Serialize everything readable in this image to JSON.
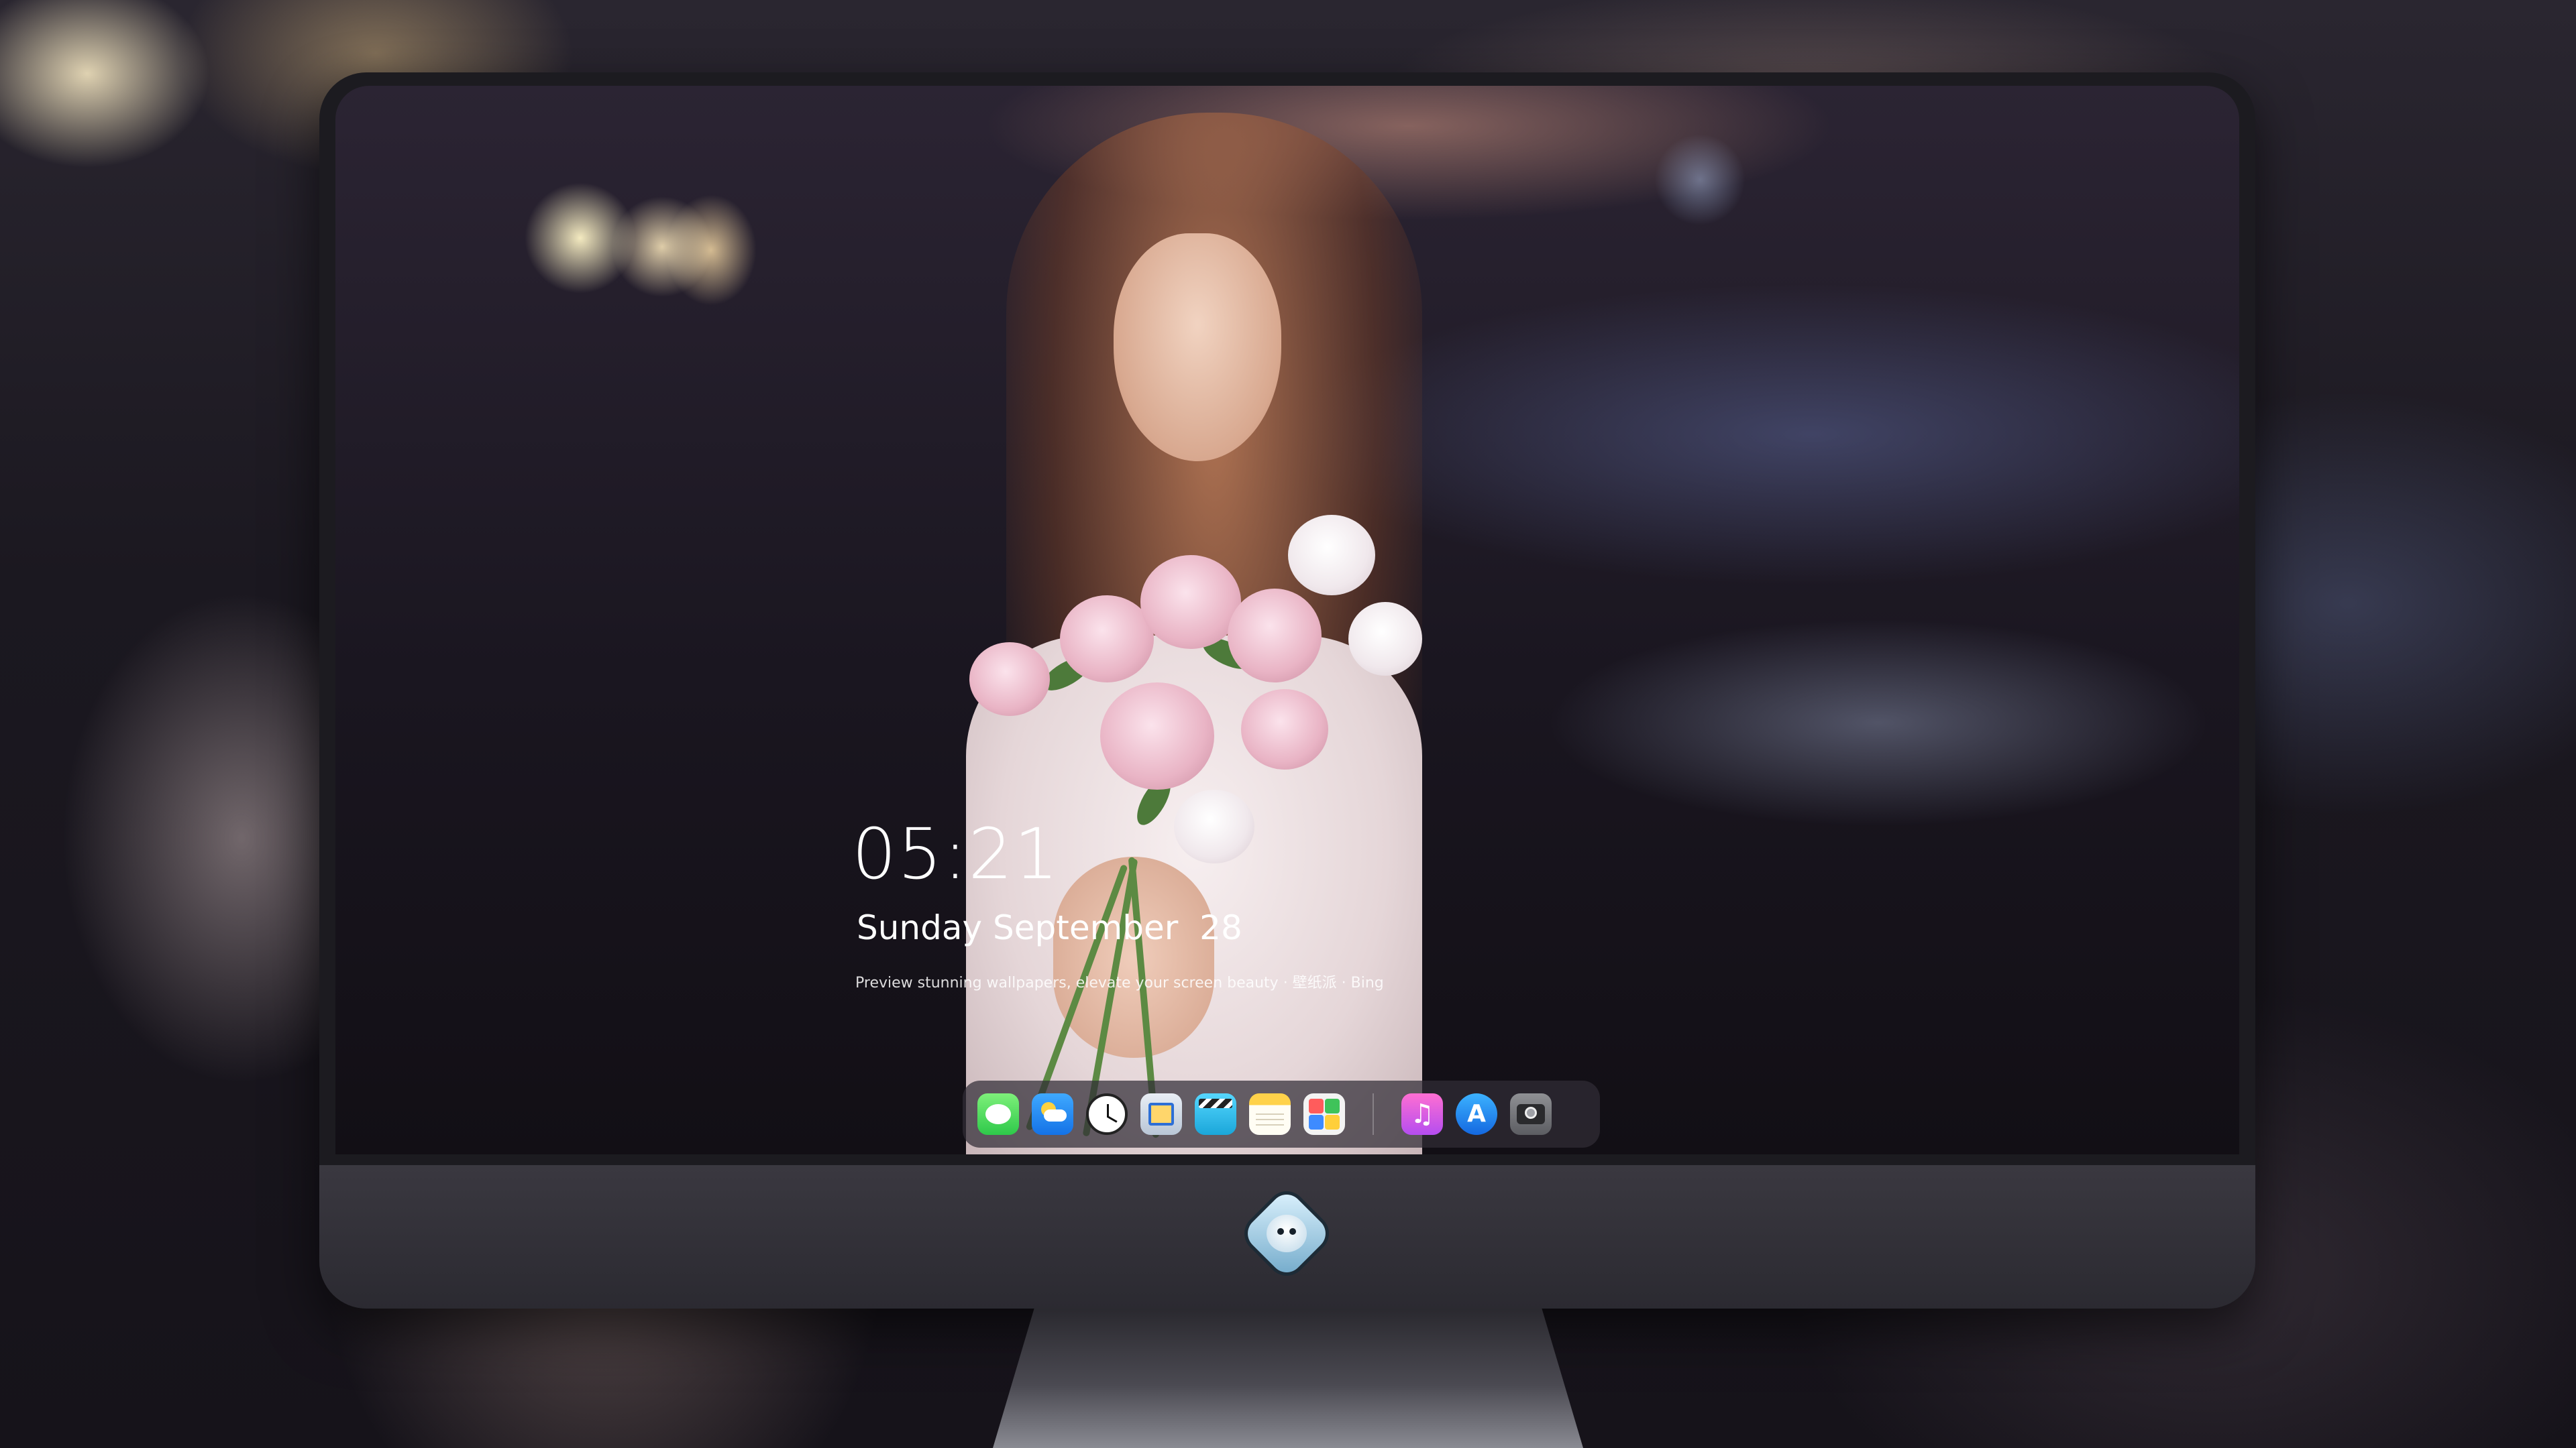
{
  "lockscreen": {
    "time": "05:21",
    "date": "Sunday September  28",
    "caption": "Preview stunning wallpapers, elevate your screen beauty · 壁纸派 · Bing"
  },
  "dock": {
    "apps": [
      {
        "name": "Messages",
        "icon": "messages-icon"
      },
      {
        "name": "Weather",
        "icon": "weather-icon"
      },
      {
        "name": "Clock",
        "icon": "clock-icon"
      },
      {
        "name": "Preview",
        "icon": "preview-icon"
      },
      {
        "name": "Clips",
        "icon": "clapperboard-icon"
      },
      {
        "name": "Notes",
        "icon": "notes-icon"
      },
      {
        "name": "Photos",
        "icon": "photos-icon"
      },
      {
        "name": "Music",
        "icon": "music-note-icon",
        "glyph": "♫"
      },
      {
        "name": "App Store",
        "icon": "app-store-icon",
        "glyph": "A"
      },
      {
        "name": "Camera",
        "icon": "camera-icon"
      }
    ]
  },
  "colors": {
    "background": "#141219",
    "monitor_bezel": "#1c1b20",
    "monitor_chin": "#3a3840",
    "dock_bg": "rgba(48,44,54,0.72)"
  }
}
